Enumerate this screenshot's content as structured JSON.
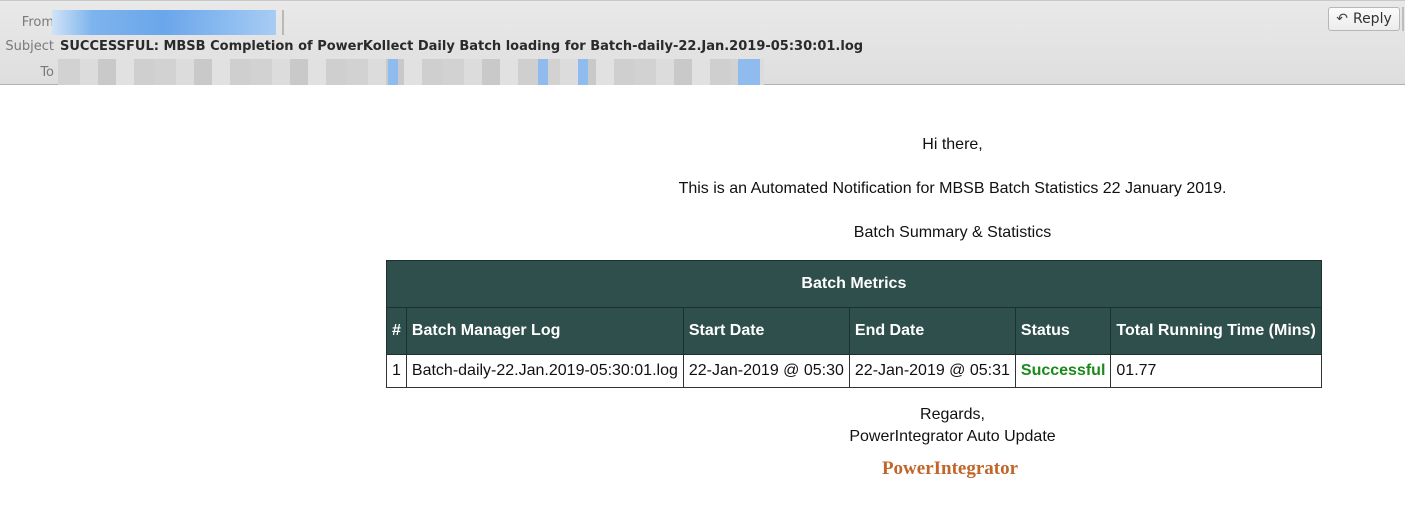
{
  "header": {
    "from_label": "From",
    "subject_label": "Subject",
    "to_label": "To",
    "subject": "SUCCESSFUL: MBSB Completion of PowerKollect Daily Batch loading for Batch-daily-22.Jan.2019-05:30:01.log",
    "reply_label": "Reply",
    "reply_icon": "reply-arrow-icon"
  },
  "body": {
    "greeting": "Hi there,",
    "intro": "This is an Automated Notification for MBSB Batch Statistics 22 January 2019.",
    "summary_heading": "Batch Summary & Statistics",
    "regards": "Regards,",
    "signature": "PowerIntegrator Auto Update",
    "brand": "PowerIntegrator"
  },
  "table": {
    "title": "Batch Metrics",
    "columns": [
      "#",
      "Batch Manager Log",
      "Start Date",
      "End Date",
      "Status",
      "Total Running Time (Mins)"
    ],
    "rows": [
      [
        "1",
        "Batch-daily-22.Jan.2019-05:30:01.log",
        "22-Jan-2019 @ 05:30",
        "22-Jan-2019 @ 05:31",
        "Successful",
        "01.77"
      ]
    ]
  },
  "colors": {
    "table_header_bg": "#2f4f4c",
    "status_success": "#1a8a1a",
    "brand": "#c0662b",
    "redaction_blue": "#7db4ee"
  }
}
